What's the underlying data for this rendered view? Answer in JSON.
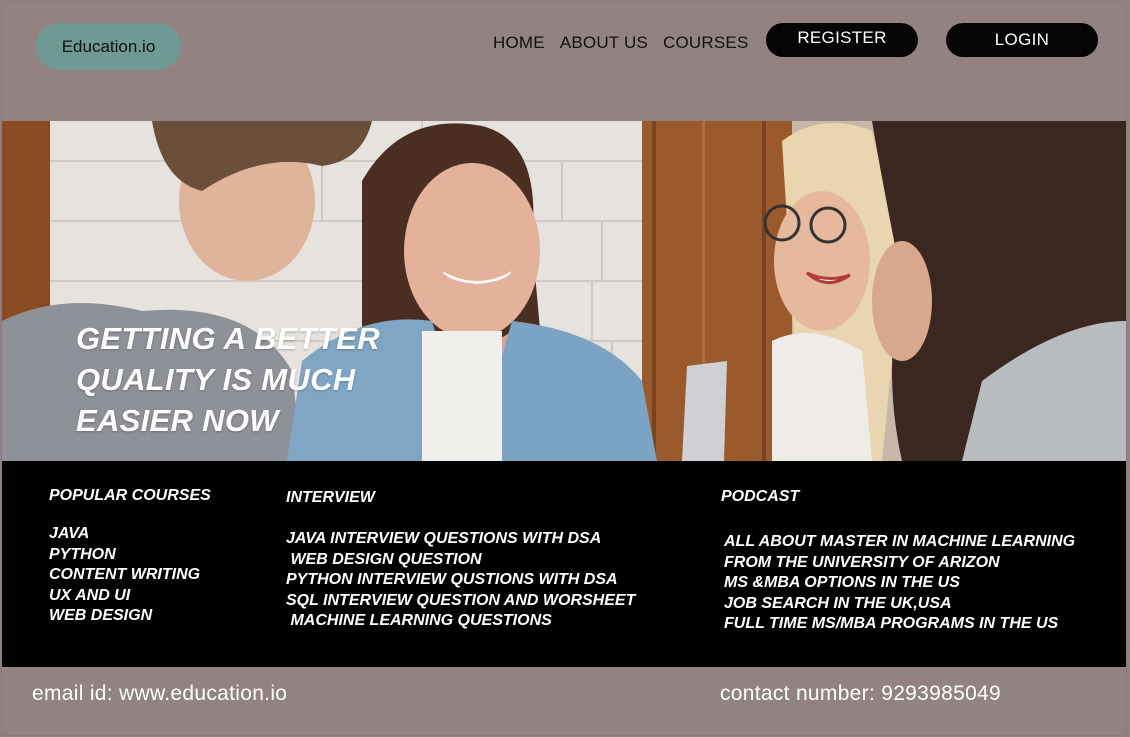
{
  "header": {
    "logo": "Education.io",
    "nav": [
      "HOME",
      "ABOUT US",
      "COURSES"
    ],
    "register_label": "REGISTER",
    "login_label": "LOGIN"
  },
  "hero": {
    "title_lines": [
      "GETTING A BETTER",
      "QUALITY IS MUCH",
      "EASIER NOW"
    ]
  },
  "footer": {
    "popular": {
      "heading": "POPULAR COURSES",
      "items": [
        "JAVA",
        "PYTHON",
        "CONTENT WRITING",
        "UX AND UI",
        "WEB DESIGN"
      ]
    },
    "interview": {
      "heading": "INTERVIEW",
      "items": [
        "JAVA INTERVIEW QUESTIONS WITH DSA",
        " WEB DESIGN QUESTION",
        "PYTHON INTERVIEW QUSTIONS WITH DSA",
        "SQL INTERVIEW QUESTION AND WORSHEET",
        " MACHINE LEARNING QUESTIONS"
      ]
    },
    "podcast": {
      "heading": "PODCAST",
      "items": [
        "ALL ABOUT MASTER IN MACHINE LEARNING",
        "FROM THE UNIVERSITY OF ARIZON",
        "MS &MBA OPTIONS IN THE US",
        "JOB SEARCH IN THE UK,USA",
        "FULL TIME MS/MBA PROGRAMS IN THE US"
      ]
    }
  },
  "contact": {
    "email": "email id: www.education.io",
    "phone": "contact number: 9293985049"
  }
}
